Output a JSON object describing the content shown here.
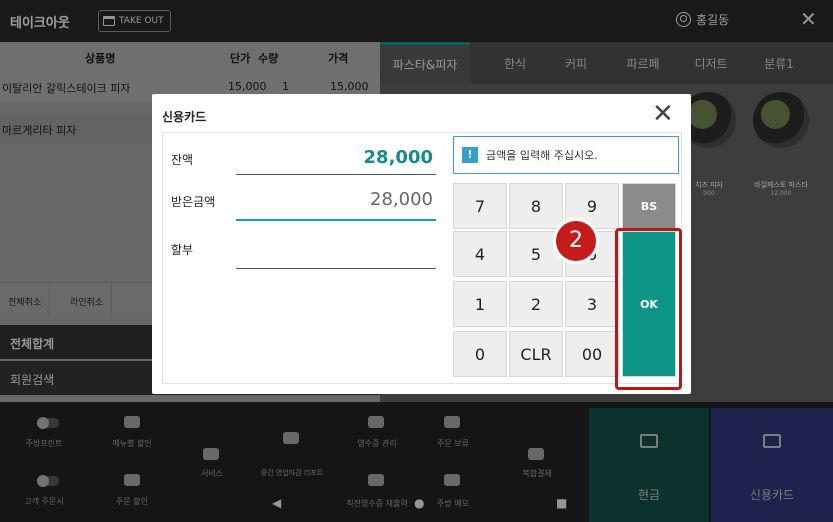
{
  "topbar": {
    "title": "테이크아웃",
    "takeout_label": "TAKE OUT",
    "user": "홍길동"
  },
  "order": {
    "headers": {
      "name": "상품명",
      "unit": "단가",
      "qty": "수량",
      "price": "가격"
    },
    "rows": [
      {
        "name": "이탈리안 갈릭스테이크 피자",
        "unit": "15,000",
        "qty": "1",
        "price": "15,000"
      },
      {
        "name": "마르게리타 피자"
      }
    ],
    "controls": {
      "cancel_all": "전체취소",
      "cancel_line": "라인취소"
    },
    "total_label": "전체합계",
    "member_search": "회원검색"
  },
  "tabs": [
    "파스타&피자",
    "한식",
    "커피",
    "파르페",
    "디저트",
    "분류1"
  ],
  "menu_items": [
    {
      "name": "치즈 피자",
      "price": "000"
    },
    {
      "name": "바질페스토 파스타",
      "price": "12,000"
    }
  ],
  "bottom": {
    "kitchen_print": "주방프린트",
    "menu_discount": "메뉴별 할인",
    "service": "서비스",
    "midterm_report": "중간 영업마감 리포트",
    "receipt_mgmt": "영수증 관리",
    "order_hold": "주문 보류",
    "split_pay": "복합결제",
    "customer_order": "고객 주문서",
    "order_discount": "주문 할인",
    "reprint_receipt": "직전영수증 재출력",
    "kitchen_memo": "주방 메모",
    "cash": "현금",
    "card": "신용카드"
  },
  "modal": {
    "title": "신용카드",
    "balance_label": "잔액",
    "balance_value": "28,000",
    "received_label": "받은금액",
    "received_value": "28,000",
    "installment_label": "할부",
    "message": "금액을 입력해 주십시오.",
    "keys": [
      "7",
      "8",
      "9",
      "4",
      "5",
      "6",
      "1",
      "2",
      "3",
      "0",
      "CLR",
      "00"
    ],
    "bs_label": "BS",
    "ok_label": "OK",
    "step_badge": "2"
  },
  "colors": {
    "accent": "#0e9585",
    "balance": "#138d86",
    "highlight": "#b51818"
  }
}
